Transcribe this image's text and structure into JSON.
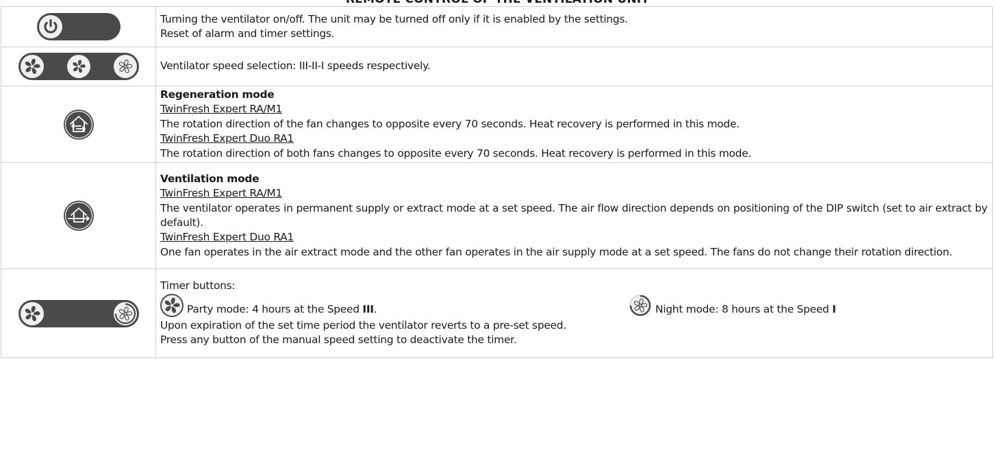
{
  "title": "REMOTE CONTROL OF THE VENTILATION UNIT",
  "rows": {
    "power": {
      "icon": "power-icon",
      "lines": [
        "Turning the ventilator on/off. The unit may be turned off only if it is enabled by the settings.",
        "Reset of alarm and timer settings."
      ]
    },
    "speed": {
      "icons": [
        "fan-speed-3-icon",
        "fan-speed-2-icon",
        "fan-speed-1-icon"
      ],
      "text": "Ventilator speed selection: III-II-I speeds respectively."
    },
    "regeneration": {
      "icon": "house-regeneration-icon",
      "heading": "Regeneration mode",
      "model_1": "TwinFresh Expert RA/M1",
      "text_1": "The rotation direction of the fan changes to opposite every 70 seconds. Heat recovery is performed in this mode.",
      "model_2": "TwinFresh Expert Duo RA1",
      "text_2": "The rotation direction of both fans changes to opposite every 70 seconds. Heat recovery is performed in this mode."
    },
    "ventilation": {
      "icon": "house-ventilation-icon",
      "heading": "Ventilation mode",
      "model_1": "TwinFresh Expert RA/M1",
      "text_1": "The ventilator operates in permanent supply or extract mode at a set speed. The air flow direction depends on positioning of the DIP switch (set to air extract by default).",
      "model_2": "TwinFresh Expert Duo RA1",
      "text_2": "One fan operates in the air extract mode and the other fan operates in the air supply mode at a set speed. The fans do not change their rotation direction."
    },
    "timer": {
      "icons": [
        "party-timer-icon",
        "night-timer-icon"
      ],
      "intro": "Timer buttons:",
      "party_text": "Party mode: 4 hours at the Speed ",
      "party_speed": "III",
      "party_end": ".",
      "night_text": "Night mode: 8 hours at the Speed ",
      "night_speed": "I",
      "line_2": "Upon expiration of the set time period the ventilator reverts to a pre-set speed.",
      "line_3": "Press any button of the manual speed setting to deactivate the timer."
    }
  },
  "colors": {
    "button_dark": "#4a4a4a",
    "button_light": "#efefef",
    "border": "#cfcfcf",
    "text": "#1a1a1a"
  }
}
